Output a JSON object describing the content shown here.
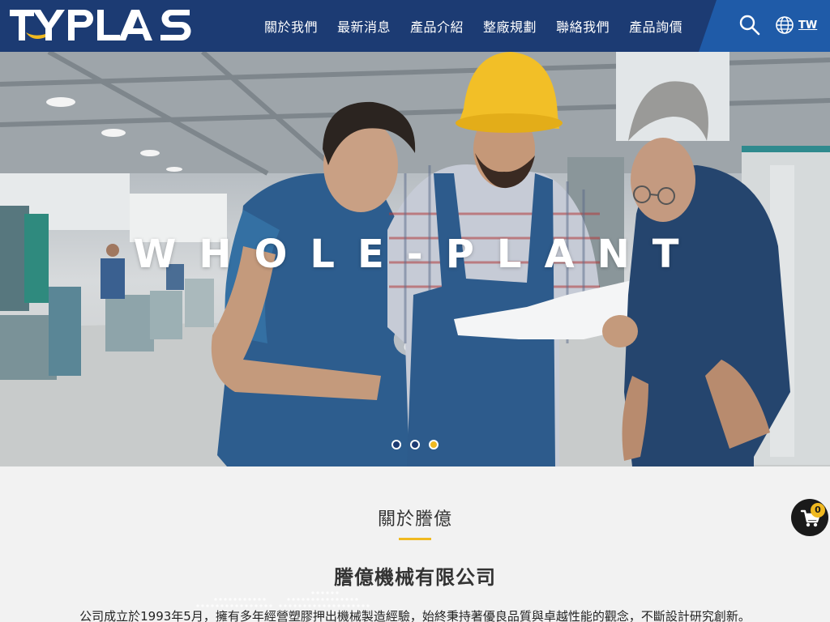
{
  "header": {
    "logo_text": "TYPLAS",
    "nav": [
      {
        "label": "關於我們"
      },
      {
        "label": "最新消息"
      },
      {
        "label": "產品介紹"
      },
      {
        "label": "整廠規劃"
      },
      {
        "label": "聯絡我們"
      },
      {
        "label": "產品詢價"
      }
    ],
    "search_icon": "search-icon",
    "language": {
      "icon": "globe-icon",
      "label": "TW"
    }
  },
  "hero": {
    "title": "WHOLE-PLANT",
    "slides": 3,
    "active_slide": 3
  },
  "about": {
    "heading": "關於謄億",
    "company_name": "謄億機械有限公司",
    "description": "公司成立於1993年5月，擁有多年經營塑膠押出機械製造經驗，始終秉持著優良品質與卓越性能的觀念，不斷設計研究創新。"
  },
  "cart": {
    "icon": "cart-icon",
    "count": "0"
  },
  "colors": {
    "header_bg": "#1c3b73",
    "header_accent": "#1f5ba8",
    "accent": "#f0b920"
  }
}
